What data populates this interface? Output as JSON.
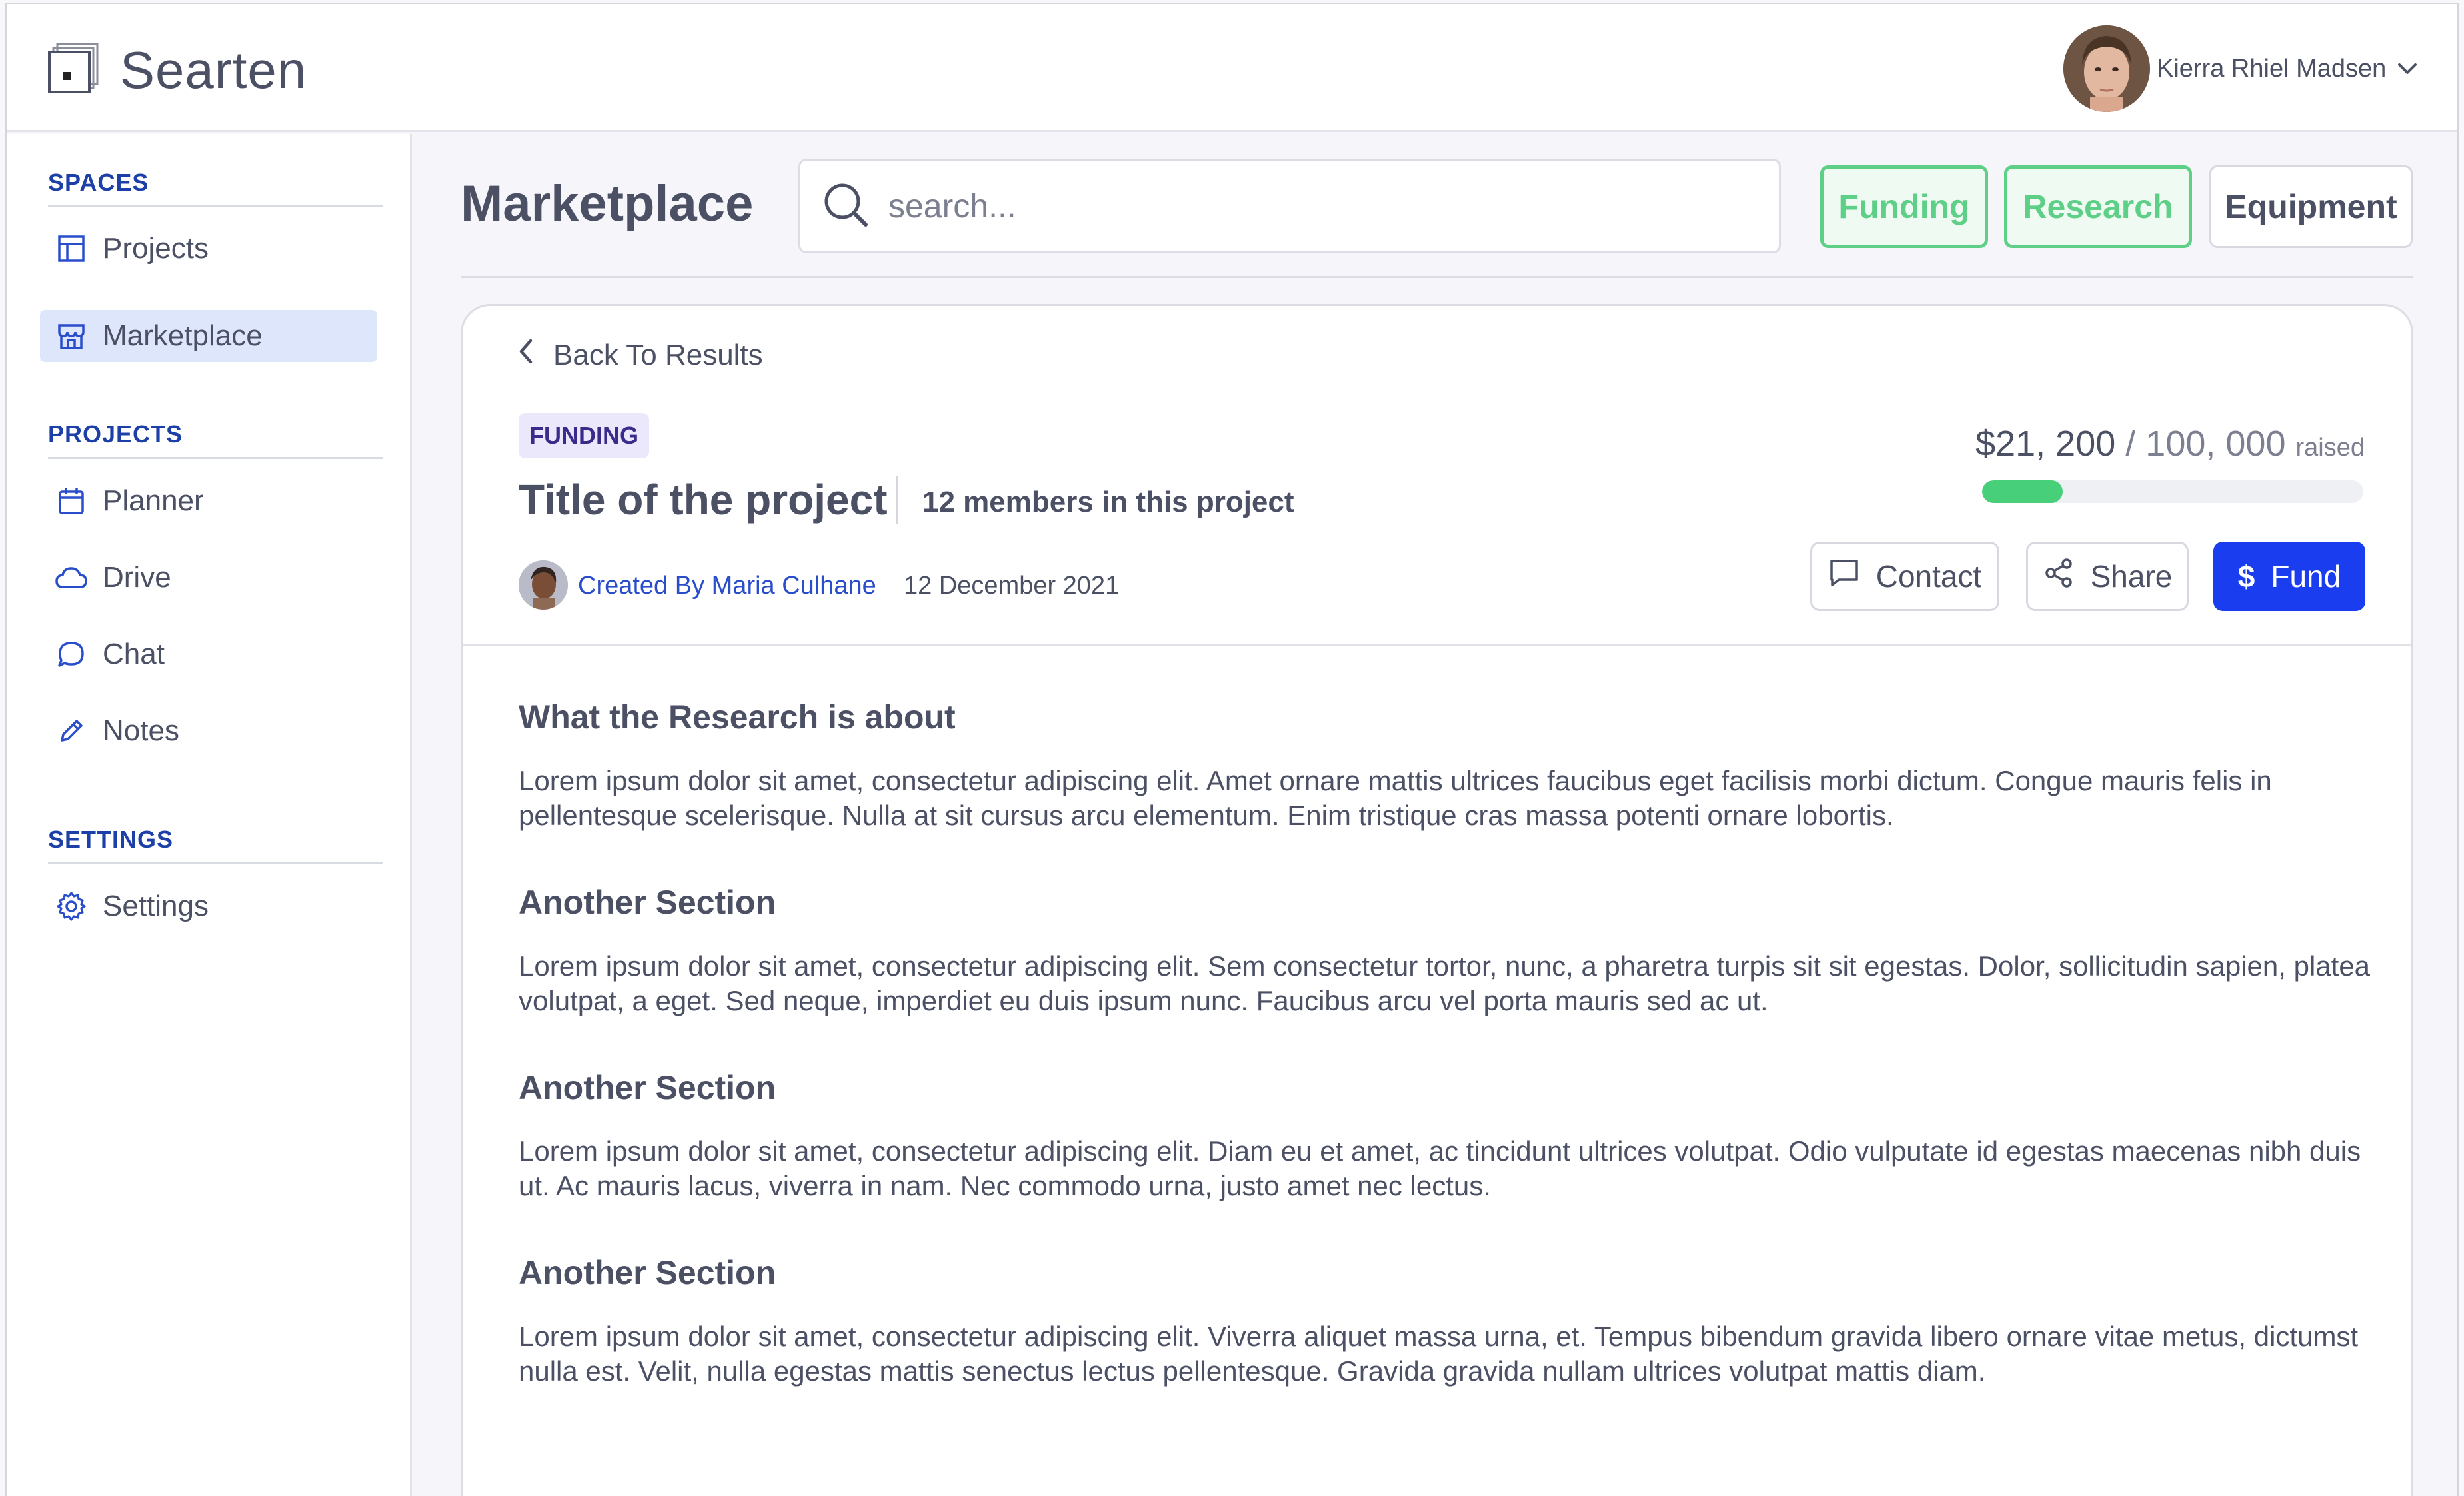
{
  "app": {
    "name": "Searten"
  },
  "user": {
    "name": "Kierra Rhiel Madsen"
  },
  "sidebar": {
    "sections": [
      {
        "heading": "SPACES",
        "items": [
          {
            "label": "Projects",
            "icon": "layout-icon"
          },
          {
            "label": "Marketplace",
            "icon": "store-icon",
            "active": true
          }
        ]
      },
      {
        "heading": "PROJECTS",
        "items": [
          {
            "label": "Planner",
            "icon": "calendar-icon"
          },
          {
            "label": "Drive",
            "icon": "cloud-icon"
          },
          {
            "label": "Chat",
            "icon": "chat-bubble-icon"
          },
          {
            "label": "Notes",
            "icon": "pencil-icon"
          }
        ]
      },
      {
        "heading": "SETTINGS",
        "items": [
          {
            "label": "Settings",
            "icon": "gear-icon"
          }
        ]
      }
    ]
  },
  "header": {
    "title": "Marketplace",
    "search_placeholder": "search...",
    "filters": [
      {
        "label": "Funding",
        "active": true
      },
      {
        "label": "Research",
        "active": true
      },
      {
        "label": "Equipment",
        "active": false
      }
    ]
  },
  "project": {
    "back_label": "Back To Results",
    "badge": "FUNDING",
    "title": "Title of the project",
    "members": "12 members in this project",
    "creator": "Created By Maria Culhane",
    "date": "12 December 2021",
    "raised_amount": "$21, 200",
    "separator": " / ",
    "goal_amount": "100, 000",
    "raised_word": "raised",
    "progress_fraction": 0.212,
    "actions": {
      "contact": "Contact",
      "share": "Share",
      "fund": "Fund"
    },
    "sections": [
      {
        "heading": "What the Research is about",
        "body": "Lorem ipsum dolor sit amet, consectetur adipiscing elit. Amet ornare mattis ultrices faucibus eget facilisis morbi dictum. Congue mauris felis in pellentesque scelerisque. Nulla at sit cursus arcu elementum. Enim tristique cras massa potenti ornare lobortis."
      },
      {
        "heading": "Another Section",
        "body": "Lorem ipsum dolor sit amet, consectetur adipiscing elit. Sem consectetur tortor, nunc, a pharetra turpis sit sit egestas. Dolor, sollicitudin sapien, platea volutpat, a eget. Sed neque, imperdiet eu duis ipsum nunc. Faucibus arcu vel porta mauris sed ac ut."
      },
      {
        "heading": "Another Section",
        "body": "Lorem ipsum dolor sit amet, consectetur adipiscing elit. Diam eu et amet, ac tincidunt ultrices volutpat. Odio vulputate id egestas maecenas nibh duis ut. Ac mauris lacus, viverra in nam. Nec commodo urna, justo amet nec lectus."
      },
      {
        "heading": "Another Section",
        "body": "Lorem ipsum dolor sit amet, consectetur adipiscing elit. Viverra aliquet massa urna, et. Tempus bibendum gravida libero ornare vitae metus, dictumst nulla est. Velit, nulla egestas mattis senectus lectus pellentesque. Gravida gravida nullam ultrices volutpat mattis diam."
      }
    ]
  },
  "colors": {
    "brand_blue": "#1a3df0",
    "link_blue": "#2a4ecb",
    "accent_green": "#5ecf86",
    "active_nav_bg": "#dde6fb"
  }
}
